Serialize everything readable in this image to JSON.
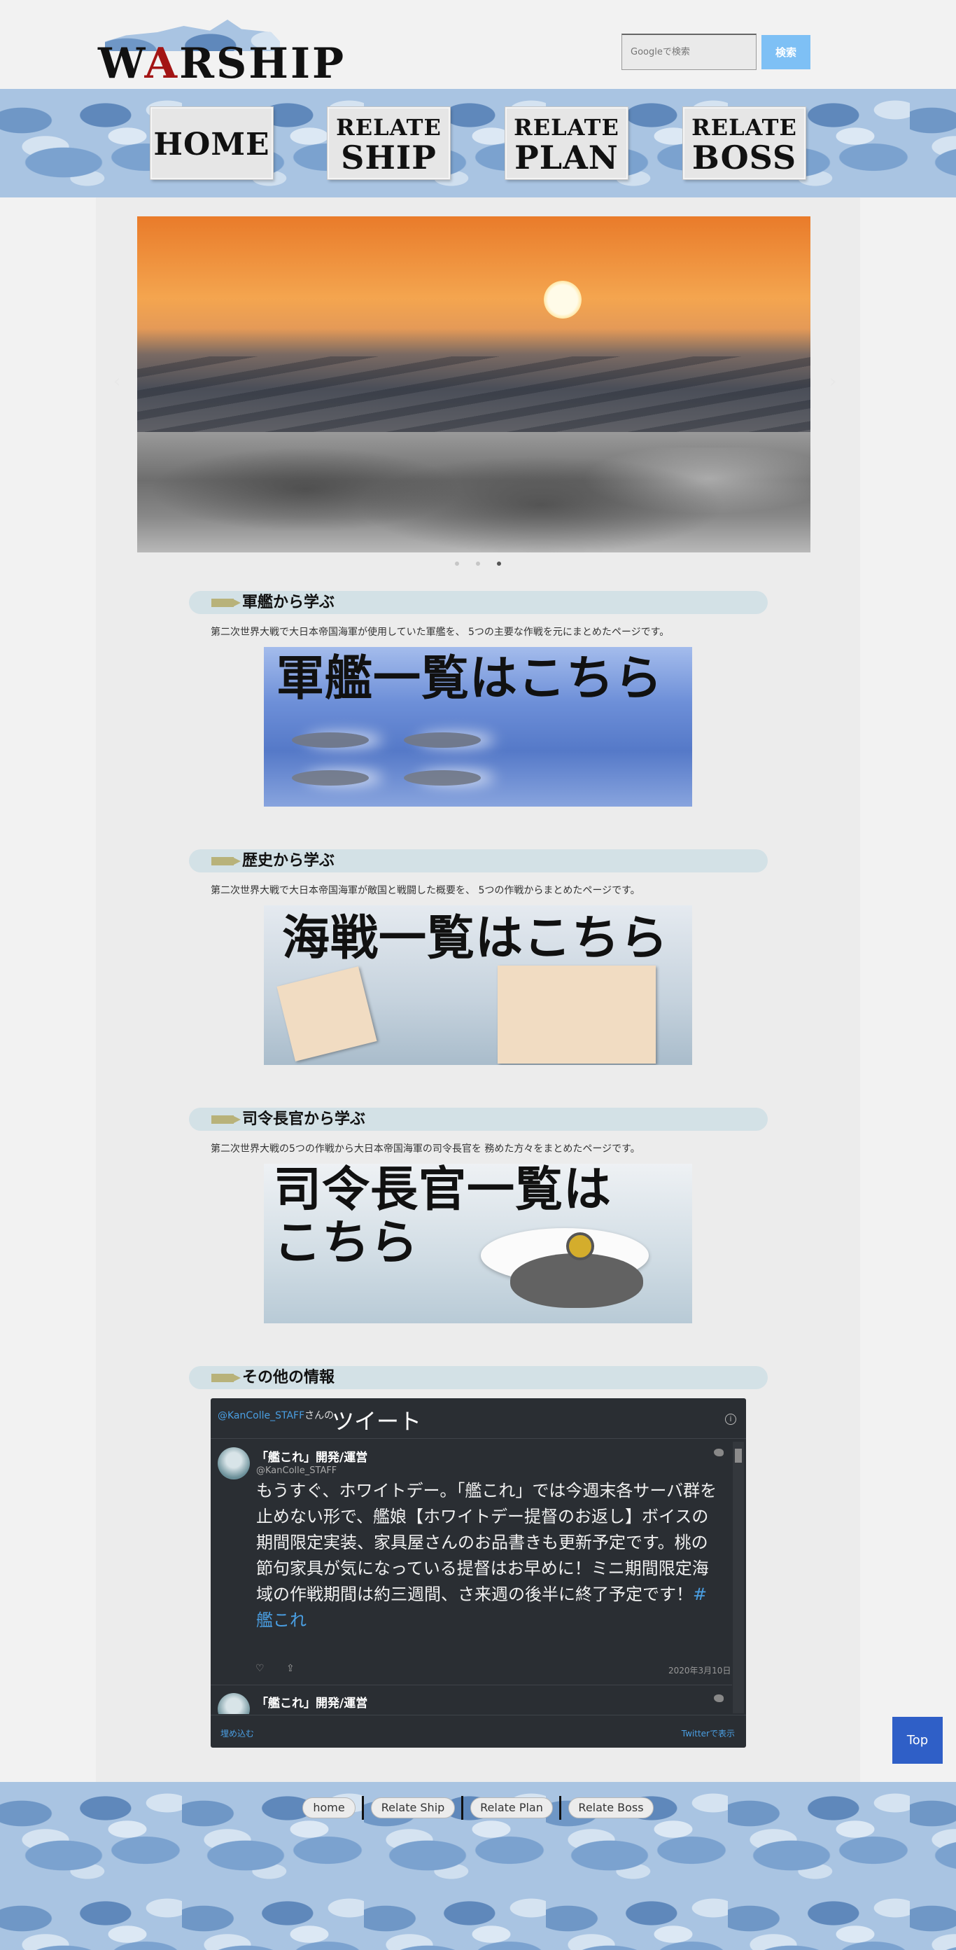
{
  "header": {
    "logo_text_pre": "W",
    "logo_text_red": "A",
    "logo_text_post": "RSHIP",
    "search_placeholder": "Googleで検索",
    "search_button": "検索"
  },
  "nav": {
    "home": "HOME",
    "ship_top": "RELATE",
    "ship_big": "SHIP",
    "plan_top": "RELATE",
    "plan_big": "PLAN",
    "boss_top": "RELATE",
    "boss_big": "BOSS"
  },
  "slider": {
    "prev": "‹",
    "next": "›",
    "dot_count": 3,
    "active_dot": 3
  },
  "sections": [
    {
      "title": "軍艦から学ぶ",
      "description": "第二次世界大戦で大日本帝国海軍が使用していた軍艦を、 5つの主要な作戦を元にまとめたページです。",
      "banner_text": "軍艦一覧はこちら"
    },
    {
      "title": "歴史から学ぶ",
      "description": "第二次世界大戦で大日本帝国海軍が敵国と戦闘した概要を、 5つの作戦からまとめたページです。",
      "banner_text": "海戦一覧はこちら"
    },
    {
      "title": "司令長官から学ぶ",
      "description": "第二次世界大戦の5つの作戦から大日本帝国海軍の司令長官を 務めた方々をまとめたページです。",
      "banner_line1": "司令長官一覧は",
      "banner_line2": "こちら"
    },
    {
      "title": "その他の情報"
    }
  ],
  "twitter": {
    "user_link": "@KanColle_STAFF",
    "user_suffix": "さんの",
    "title": "ツイート",
    "info": "i",
    "tweet": {
      "name": "「艦これ」開発/運営",
      "handle": "@KanColle_STAFF",
      "text": "もうすぐ、ホワイトデー。「艦これ」では今週末各サーバ群を止めない形で、艦娘【ホワイトデー提督のお返し】ボイスの期間限定実装、家具屋さんのお品書きも更新予定です。桃の節句家具が気になっている提督はお早めに！ミニ期間限定海域の作戦期間は約三週間、さ来週の後半に終了予定です！",
      "hashtag": "#艦これ",
      "heart": "♡",
      "share": "⇪",
      "date": "2020年3月10日"
    },
    "tweet2_name": "「艦これ」開発/運営",
    "embed": "埋め込む",
    "view_on_twitter": "Twitterで表示"
  },
  "top_button": "Top",
  "footer": {
    "links": [
      "home",
      "Relate Ship",
      "Relate Plan",
      "Relate Boss"
    ]
  },
  "colors": {
    "search_button": "#7ec0f5",
    "section_bar": "#d3e1e6",
    "top_button": "#2f5fc7",
    "twitter_bg": "#2a2e33",
    "link": "#4a9fe3",
    "logo_red": "#a31515"
  }
}
